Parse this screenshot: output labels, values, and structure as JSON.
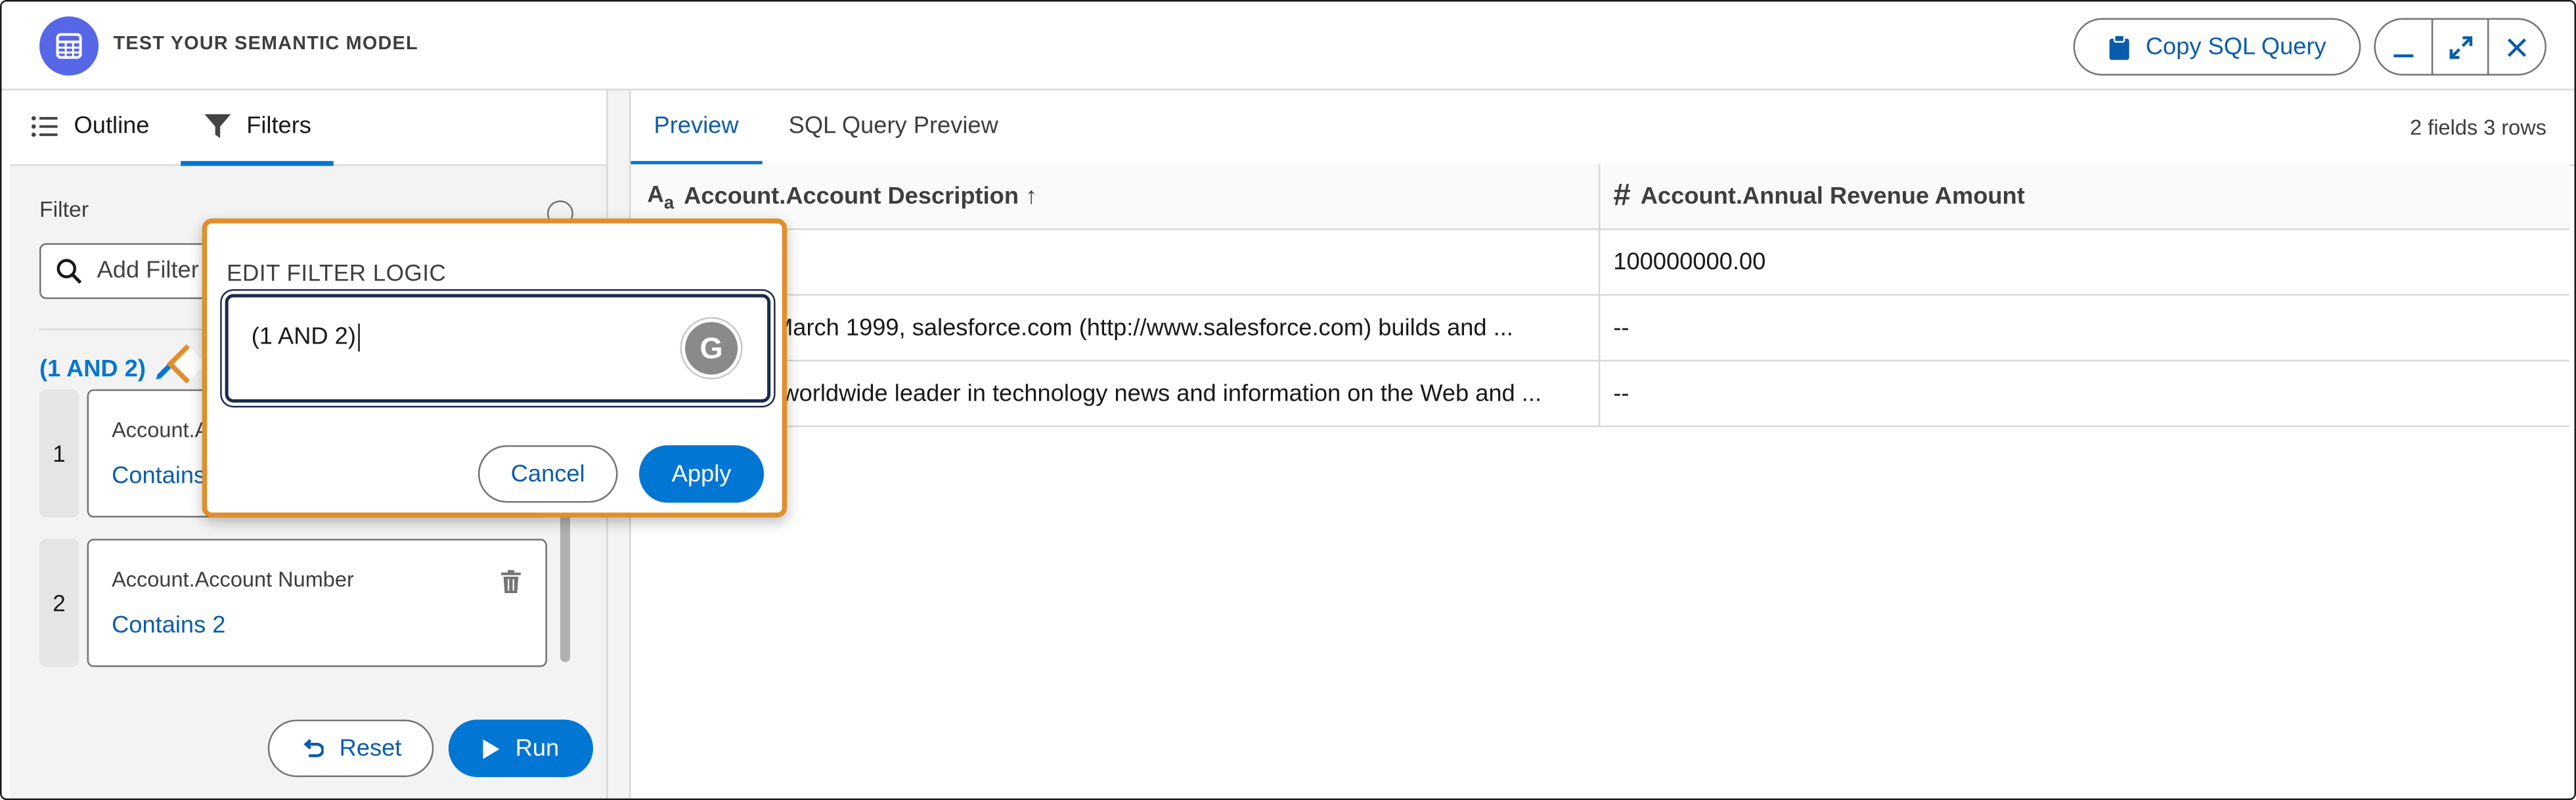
{
  "header": {
    "title": "TEST YOUR SEMANTIC MODEL",
    "copy_sql_label": "Copy SQL Query"
  },
  "left_panel": {
    "tabs": [
      {
        "label": "Outline",
        "icon": "list-icon"
      },
      {
        "label": "Filters",
        "icon": "filter-icon",
        "active": true
      }
    ],
    "filter_label": "Filter",
    "add_filter_placeholder": "Add Filter",
    "logic_label": "(1 AND 2)",
    "filters": [
      {
        "number": "1",
        "name": "Account.Account Description",
        "value": "Contains 1"
      },
      {
        "number": "2",
        "name": "Account.Account Number",
        "value": "Contains 2"
      }
    ],
    "reset_label": "Reset",
    "run_label": "Run"
  },
  "right_panel": {
    "tabs": [
      {
        "label": "Preview",
        "active": true
      },
      {
        "label": "SQL Query Preview"
      }
    ],
    "summary": "2 fields 3 rows",
    "columns": [
      {
        "icon_text": "Aa",
        "label": "Account.Account Description ↑"
      },
      {
        "icon_text": "#",
        "label": "Account.Annual Revenue Amount"
      }
    ],
    "rows": [
      [
        "",
        "100000000.00"
      ],
      [
        "Founded in March 1999, salesforce.com (http://www.salesforce.com) builds and ...",
        "--"
      ],
      [
        "CNET is the worldwide leader in technology news and information on the Web and ...",
        "--"
      ]
    ]
  },
  "popover": {
    "title": "EDIT FILTER LOGIC",
    "logic_value": "(1 AND 2)",
    "cancel_label": "Cancel",
    "apply_label": "Apply",
    "highlight_color": "#e08f2c"
  },
  "colors": {
    "brand_blue": "#0176d3",
    "link_blue": "#0b5cab",
    "app_icon": "#5867e8"
  }
}
